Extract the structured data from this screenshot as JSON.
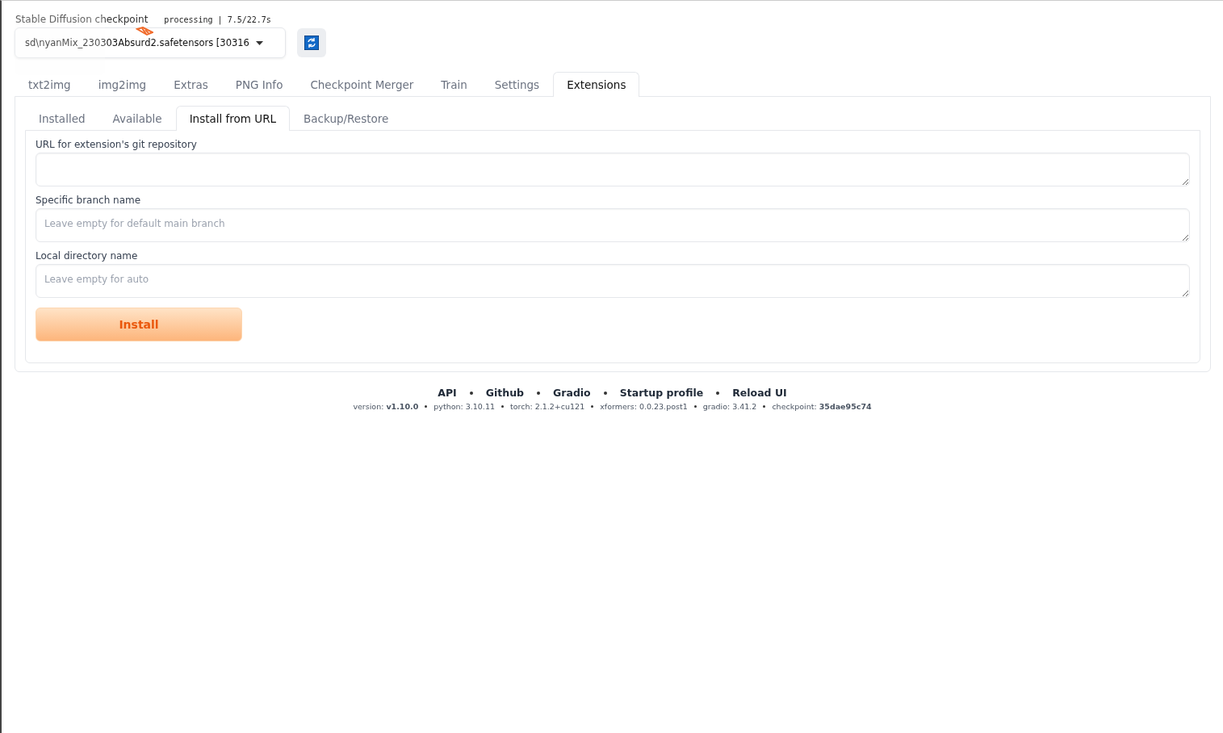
{
  "checkpoint": {
    "label": "Stable Diffusion checkpoint",
    "value": "sd\\nyanMix_230303Absurd2.safetensors [30316",
    "progress": "processing | 7.5/22.7s"
  },
  "tabs": [
    {
      "label": "txt2img",
      "selected": false
    },
    {
      "label": "img2img",
      "selected": false
    },
    {
      "label": "Extras",
      "selected": false
    },
    {
      "label": "PNG Info",
      "selected": false
    },
    {
      "label": "Checkpoint Merger",
      "selected": false
    },
    {
      "label": "Train",
      "selected": false
    },
    {
      "label": "Settings",
      "selected": false
    },
    {
      "label": "Extensions",
      "selected": true
    }
  ],
  "subtabs": [
    {
      "label": "Installed",
      "selected": false
    },
    {
      "label": "Available",
      "selected": false
    },
    {
      "label": "Install from URL",
      "selected": true
    },
    {
      "label": "Backup/Restore",
      "selected": false
    }
  ],
  "fields": [
    {
      "label": "URL for extension's git repository"
    },
    {
      "label": "Specific branch name",
      "placeholder": "Leave empty for default main branch"
    },
    {
      "label": "Local directory name",
      "placeholder": "Leave empty for auto"
    }
  ],
  "install_button": "Install",
  "footer": {
    "links": [
      "API",
      "Github",
      "Gradio",
      "Startup profile",
      "Reload UI"
    ],
    "versions": [
      "version: **v1.10.0**",
      "python: 3.10.11",
      "torch: 2.1.2+cu121",
      "xformers: 0.0.23.post1",
      "gradio: 3.41.2",
      "checkpoint: **35dae95c74**"
    ]
  }
}
